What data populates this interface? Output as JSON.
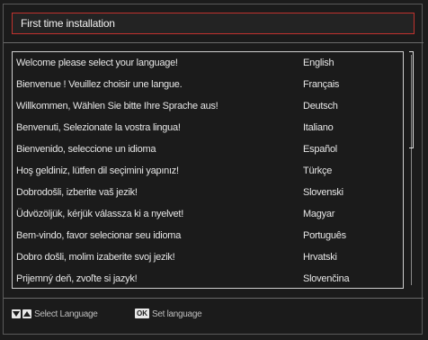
{
  "window": {
    "title": "First time installation"
  },
  "languages": [
    {
      "message": "Welcome please select your language!",
      "language": "English"
    },
    {
      "message": "Bienvenue ! Veuillez choisir une langue.",
      "language": "Français"
    },
    {
      "message": "Willkommen, Wählen Sie bitte Ihre Sprache aus!",
      "language": "Deutsch"
    },
    {
      "message": "Benvenuti, Selezionate la vostra lingua!",
      "language": "Italiano"
    },
    {
      "message": "Bienvenido, seleccione un idioma",
      "language": "Español"
    },
    {
      "message": "Hoş geldiniz, lütfen dil seçimini yapınız!",
      "language": "Türkçe"
    },
    {
      "message": "Dobrodošli, izberite vaš jezik!",
      "language": "Slovenski"
    },
    {
      "message": "Üdvözöljük, kérjük válassza ki a nyelvet!",
      "language": "Magyar"
    },
    {
      "message": "Bem-vindo, favor selecionar seu idioma",
      "language": "Português"
    },
    {
      "message": "Dobro došli, molim izaberite svoj jezik!",
      "language": "Hrvatski"
    },
    {
      "message": "Prijemný deň, zvoľte si jazyk!",
      "language": "Slovenčina"
    }
  ],
  "selected_language": "English",
  "footer": {
    "select_hint": "Select Language",
    "ok_key_label": "OK",
    "set_hint": "Set language"
  },
  "colors": {
    "background": "#1b1b1b",
    "title_border": "#c0322e",
    "text": "#e6e6e6"
  }
}
